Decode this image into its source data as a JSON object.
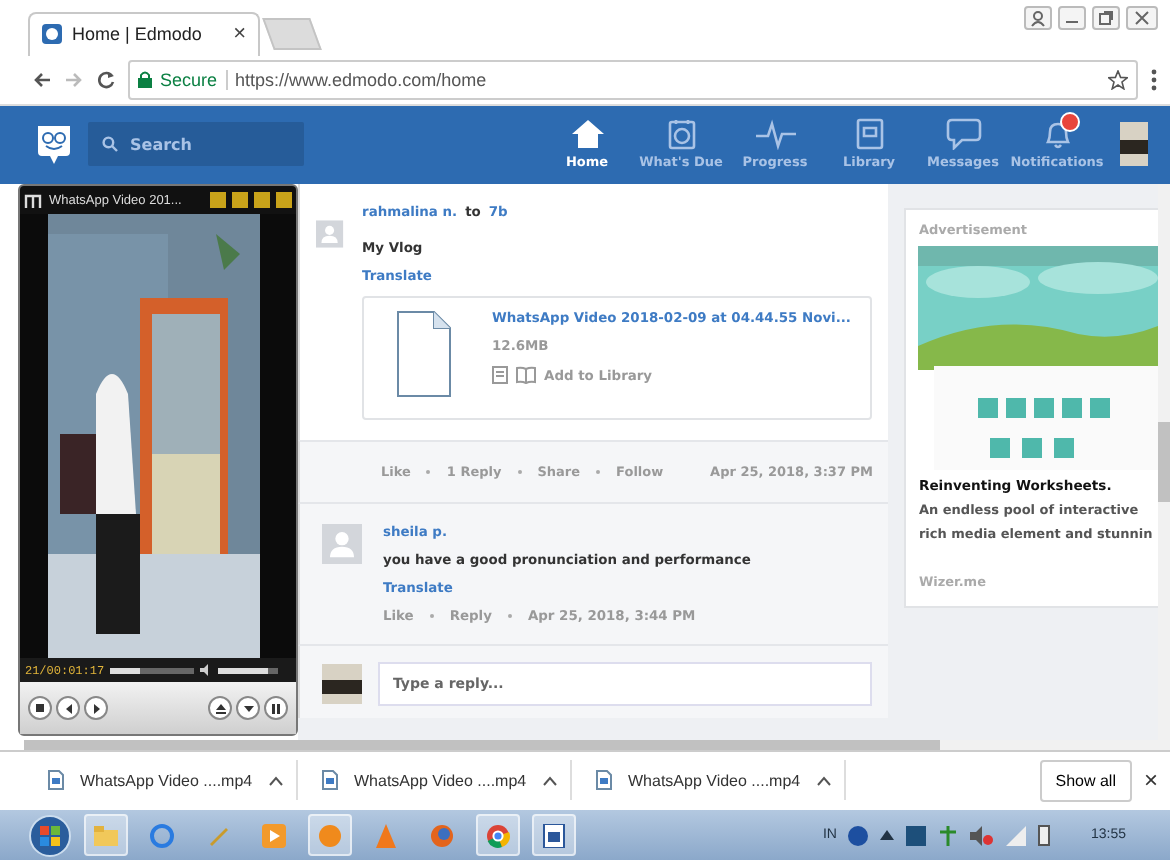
{
  "browser": {
    "tabs": [
      {
        "title": "Home | Edmodo",
        "selected": true,
        "close": "×"
      }
    ],
    "secure_label": "Secure",
    "url": "https://www.edmodo.com/home"
  },
  "nav": {
    "search_placeholder": "Search",
    "items": [
      {
        "label": "Home",
        "kind": "home",
        "selected": true
      },
      {
        "label": "What's Due",
        "kind": "due",
        "selected": false
      },
      {
        "label": "Progress",
        "kind": "progress",
        "selected": false
      },
      {
        "label": "Library",
        "kind": "library",
        "selected": false
      },
      {
        "label": "Messages",
        "kind": "messages",
        "selected": false
      },
      {
        "label": "Notifications",
        "kind": "notifications",
        "selected": false,
        "badge": true
      }
    ]
  },
  "player": {
    "title": "WhatsApp Video 201...",
    "time": "21/00:01:17",
    "seek": {
      "level": 0.36
    },
    "volume": {
      "level": 0.82
    }
  },
  "post": {
    "author": "rahmalina n.",
    "to_word": "to",
    "group": "7b",
    "body": "My Vlog",
    "translate": "Translate",
    "attachment": {
      "title": "WhatsApp Video 2018-02-09 at 04.44.55 Novi...",
      "size": "12.6MB",
      "action": "Add to Library"
    },
    "actions": [
      "Like",
      "1 Reply",
      "Share",
      "Follow"
    ],
    "time": "Apr 25, 2018, 3:37 PM",
    "comments": [
      {
        "author": "sheila p.",
        "text": "you have a good pronunciation and performance",
        "translate": "Translate",
        "actions": [
          "Like",
          "Reply"
        ],
        "time": "Apr 25, 2018, 3:44 PM"
      }
    ],
    "reply_placeholder": "Type a reply..."
  },
  "ad": {
    "heading": "Advertisement",
    "image": {
      "kind": "picture"
    },
    "title": "Reinventing Worksheets.",
    "lines": [
      "An endless pool of interactive",
      "rich media element and stunnin"
    ],
    "source": "Wizer.me"
  },
  "downloads": {
    "items": [
      "WhatsApp Video ....mp4",
      "WhatsApp Video ....mp4",
      "WhatsApp Video ....mp4"
    ],
    "show_all": "Show all",
    "close": "×"
  },
  "taskbar": {
    "language": "IN",
    "clock": "13:55"
  }
}
